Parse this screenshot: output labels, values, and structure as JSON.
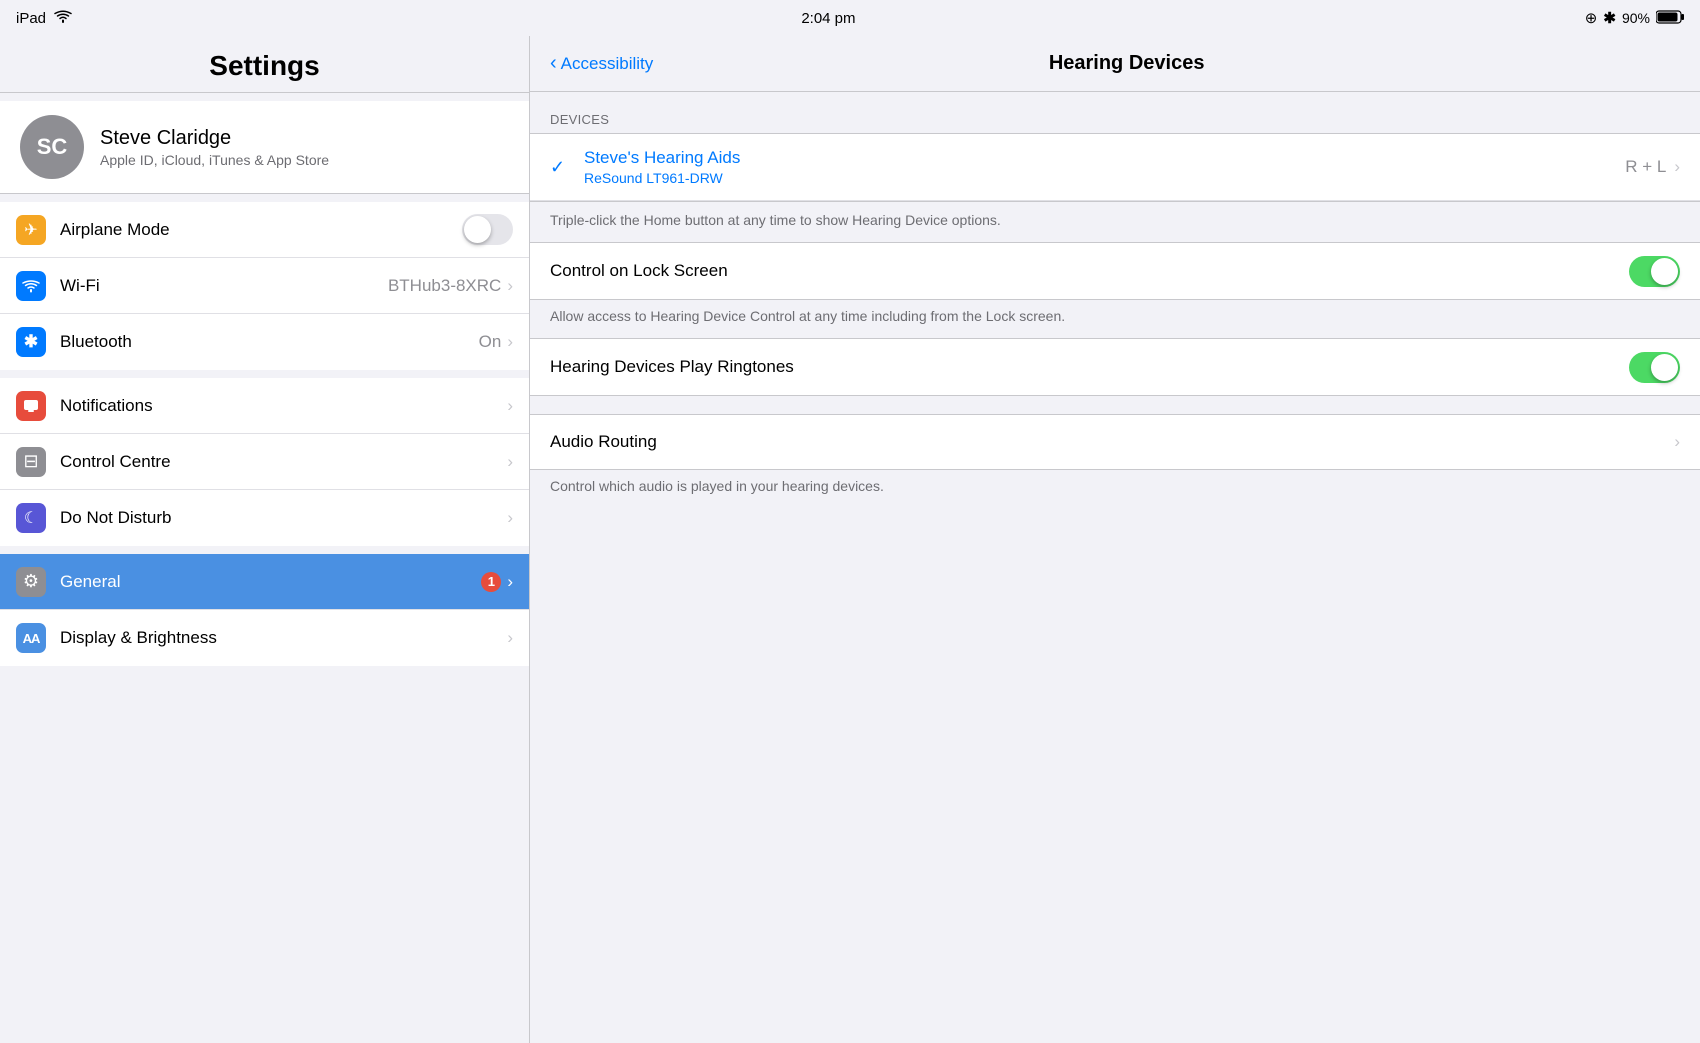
{
  "statusBar": {
    "device": "iPad",
    "wifi": "wifi",
    "time": "2:04 pm",
    "location": "⊕",
    "bluetooth": "bluetooth",
    "battery": "90%"
  },
  "leftPanel": {
    "title": "Settings",
    "user": {
      "initials": "SC",
      "name": "Steve Claridge",
      "subtitle": "Apple ID, iCloud, iTunes & App Store"
    },
    "items": [
      {
        "id": "airplane",
        "icon": "✈",
        "iconClass": "icon-orange",
        "label": "Airplane Mode",
        "value": "",
        "toggle": "off",
        "badge": null
      },
      {
        "id": "wifi",
        "icon": "wifi",
        "iconClass": "icon-blue2",
        "label": "Wi-Fi",
        "value": "BTHub3-8XRC",
        "toggle": null,
        "badge": null
      },
      {
        "id": "bluetooth",
        "icon": "bt",
        "iconClass": "icon-blue2",
        "label": "Bluetooth",
        "value": "On",
        "toggle": null,
        "badge": null
      },
      {
        "id": "notifications",
        "icon": "🔔",
        "iconClass": "icon-red",
        "label": "Notifications",
        "value": "",
        "toggle": null,
        "badge": null
      },
      {
        "id": "controlcentre",
        "icon": "⊟",
        "iconClass": "icon-gray",
        "label": "Control Centre",
        "value": "",
        "toggle": null,
        "badge": null
      },
      {
        "id": "donotdisturb",
        "icon": "☾",
        "iconClass": "icon-purple",
        "label": "Do Not Disturb",
        "value": "",
        "toggle": null,
        "badge": null
      },
      {
        "id": "general",
        "icon": "⚙",
        "iconClass": "icon-gear",
        "label": "General",
        "value": "",
        "toggle": null,
        "badge": "1",
        "active": true
      },
      {
        "id": "displaybrightness",
        "icon": "AA",
        "iconClass": "icon-aa",
        "label": "Display & Brightness",
        "value": "",
        "toggle": null,
        "badge": null
      }
    ]
  },
  "rightPanel": {
    "backLabel": "Accessibility",
    "title": "Hearing Devices",
    "sectionHeader": "DEVICES",
    "device": {
      "name": "Steve's Hearing Aids",
      "model": "ReSound LT961-DRW",
      "channel": "R + L"
    },
    "tripleClickNote": "Triple-click the Home button at any time to show Hearing Device options.",
    "settings": [
      {
        "id": "controlLockScreen",
        "label": "Control on Lock Screen",
        "toggleState": "on",
        "description": "Allow access to Hearing Device Control at any time including from the Lock screen."
      },
      {
        "id": "hearingDevicesRingtones",
        "label": "Hearing Devices Play Ringtones",
        "toggleState": "on",
        "description": null
      }
    ],
    "audioRouting": {
      "label": "Audio Routing",
      "description": "Control which audio is played in your hearing devices."
    }
  }
}
